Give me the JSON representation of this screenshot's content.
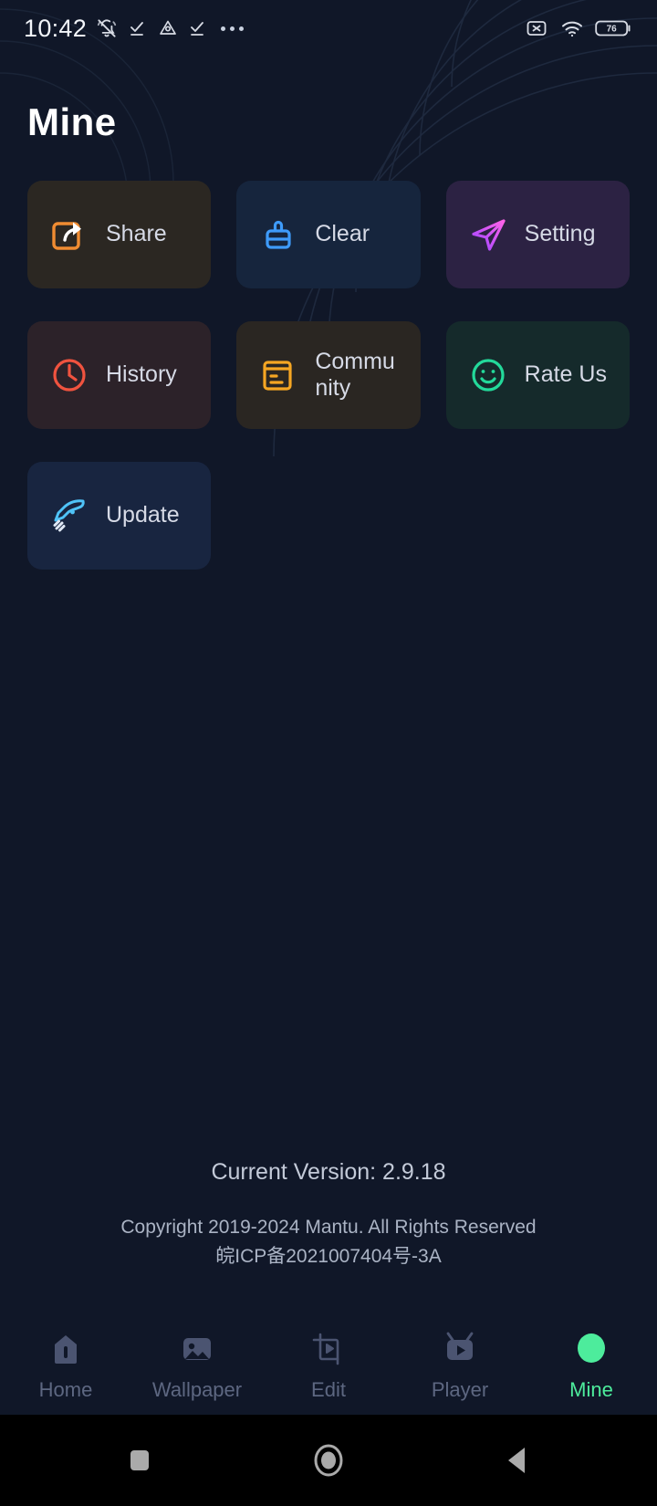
{
  "status_bar": {
    "time": "10:42",
    "battery_level": "76",
    "left_icons": [
      "bell-muted-icon",
      "check-underline-icon",
      "triangle-drop-icon",
      "check-underline-icon",
      "more-dots-icon"
    ],
    "right_icons": [
      "sim-x-icon",
      "wifi-icon",
      "battery-icon"
    ]
  },
  "header": {
    "title": "Mine"
  },
  "menu": {
    "items": [
      {
        "id": "share",
        "label": "Share",
        "icon": "share-arrow-icon",
        "bg": "#2b2722",
        "accent": "#f08c32"
      },
      {
        "id": "clear",
        "label": "Clear",
        "icon": "broom-icon",
        "bg": "#16253d",
        "accent": "#3e9bfa"
      },
      {
        "id": "setting",
        "label": "Setting",
        "icon": "paper-plane-icon",
        "bg": "#2c2243",
        "accent": "#d martial"
      },
      {
        "id": "history",
        "label": "History",
        "icon": "clock-icon",
        "bg": "#2c2229",
        "accent": "#f0533f"
      },
      {
        "id": "community",
        "label": "Community",
        "icon": "document-list-icon",
        "bg": "#2a2622",
        "accent": "#f5a623"
      },
      {
        "id": "rate",
        "label": "Rate Us",
        "icon": "smiley-face-icon",
        "bg": "#152a2b",
        "accent": "#23d99a"
      },
      {
        "id": "update",
        "label": "Update",
        "icon": "rocket-icon",
        "bg": "#182540",
        "accent": "#4fc3f7"
      }
    ]
  },
  "footer": {
    "version": "Current Version: 2.9.18",
    "copyright_line1": "Copyright  2019-2024 Mantu. All Rights Reserved",
    "copyright_line2": "皖ICP备2021007404号-3A"
  },
  "tabbar": {
    "active_id": "mine",
    "active_color": "#4dec9c",
    "inactive_color": "#5d6781",
    "items": [
      {
        "id": "home",
        "label": "Home",
        "icon": "house-icon"
      },
      {
        "id": "wallpaper",
        "label": "Wallpaper",
        "icon": "image-icon"
      },
      {
        "id": "edit",
        "label": "Edit",
        "icon": "crop-play-icon"
      },
      {
        "id": "player",
        "label": "Player",
        "icon": "tv-play-icon"
      },
      {
        "id": "mine",
        "label": "Mine",
        "icon": "avatar-circle-icon"
      }
    ]
  },
  "system_nav": {
    "buttons": [
      "recents-square-icon",
      "home-circle-icon",
      "back-triangle-icon"
    ]
  }
}
